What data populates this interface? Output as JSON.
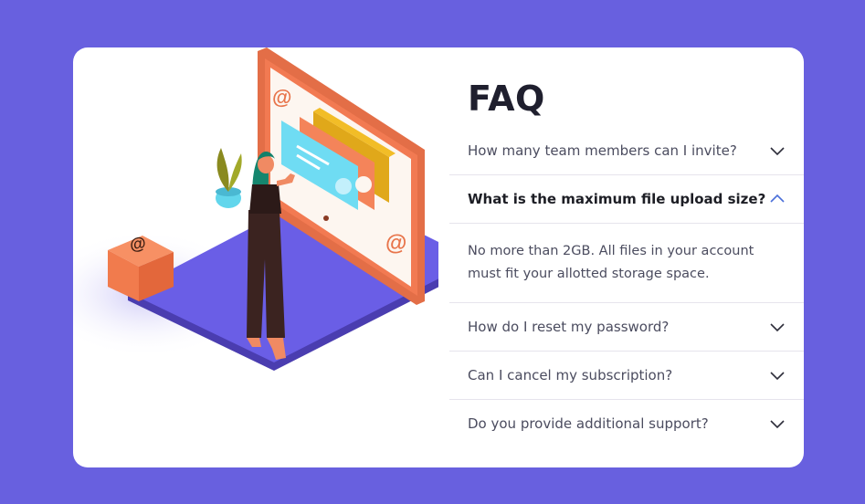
{
  "faq": {
    "title": "FAQ",
    "items": [
      {
        "question": "How many team members can I invite?",
        "open": false,
        "icon": "chevron-down-icon"
      },
      {
        "question": "What is the maximum file upload size?",
        "open": true,
        "icon": "chevron-up-icon",
        "answer": "No more than 2GB. All files in your account must fit your allotted storage space."
      },
      {
        "question": "How do I reset my password?",
        "open": false,
        "icon": "chevron-down-icon"
      },
      {
        "question": "Can I cancel my subscription?",
        "open": false,
        "icon": "chevron-down-icon"
      },
      {
        "question": "Do you provide additional support?",
        "open": false,
        "icon": "chevron-down-icon"
      }
    ]
  },
  "colors": {
    "page_background": "#6860df",
    "card_background": "#ffffff",
    "title_text": "#1f1f2e",
    "question_text": "#4b4c5f",
    "open_question_text": "#1d1e25",
    "open_chevron": "#4a6fd9",
    "closed_chevron": "#2d2d3a",
    "divider": "#e6e4ec"
  }
}
